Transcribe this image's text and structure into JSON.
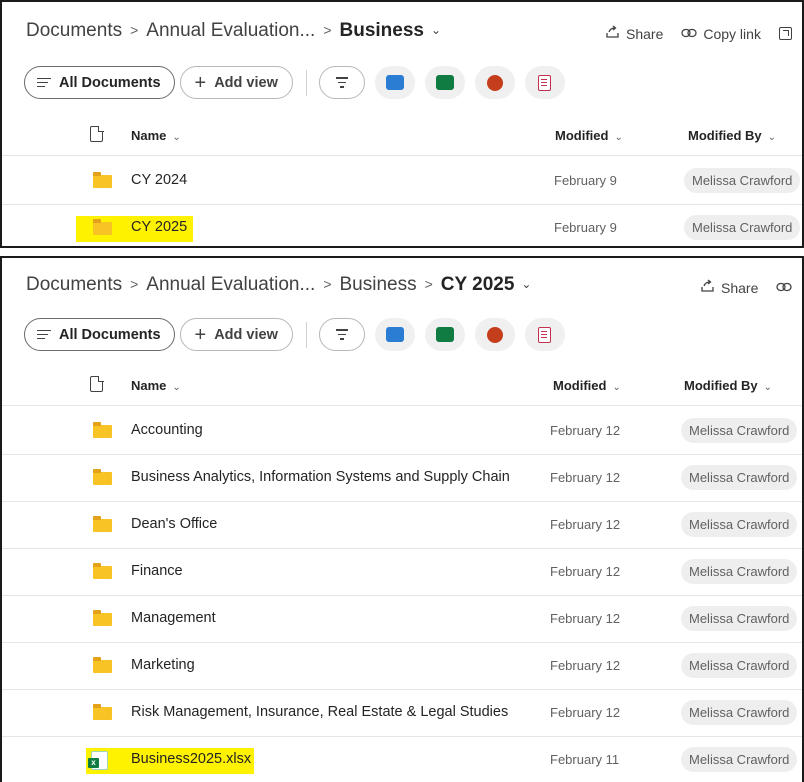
{
  "top_view": {
    "breadcrumb": {
      "items": [
        "Documents",
        "Annual Evaluation..."
      ],
      "current": "Business",
      "separator": ">",
      "chevron": "⌄"
    },
    "actions": {
      "share_label": "Share",
      "copy_link_label": "Copy link"
    },
    "toolbar": {
      "all_documents_label": "All Documents",
      "add_view_label": "Add view",
      "add_icon": "+"
    },
    "columns": {
      "name": "Name",
      "modified": "Modified",
      "modified_by": "Modified By",
      "sort_chevron": "⌄"
    },
    "rows": [
      {
        "name": "CY 2024",
        "modified": "February 9",
        "modified_by": "Melissa Crawford",
        "type": "folder",
        "highlighted": false
      },
      {
        "name": "CY 2025",
        "modified": "February 9",
        "modified_by": "Melissa Crawford",
        "type": "folder",
        "highlighted": true
      }
    ]
  },
  "bottom_view": {
    "breadcrumb": {
      "items": [
        "Documents",
        "Annual Evaluation...",
        "Business"
      ],
      "current": "CY 2025",
      "separator": ">",
      "chevron": "⌄"
    },
    "actions": {
      "share_label": "Share"
    },
    "toolbar": {
      "all_documents_label": "All Documents",
      "add_view_label": "Add view",
      "add_icon": "+"
    },
    "columns": {
      "name": "Name",
      "modified": "Modified",
      "modified_by": "Modified By",
      "sort_chevron": "⌄"
    },
    "rows": [
      {
        "name": "Accounting",
        "modified": "February 12",
        "modified_by": "Melissa Crawford",
        "type": "folder",
        "highlighted": false
      },
      {
        "name": "Business Analytics, Information Systems and Supply Chain",
        "modified": "February 12",
        "modified_by": "Melissa Crawford",
        "type": "folder",
        "highlighted": false
      },
      {
        "name": "Dean's Office",
        "modified": "February 12",
        "modified_by": "Melissa Crawford",
        "type": "folder",
        "highlighted": false
      },
      {
        "name": "Finance",
        "modified": "February 12",
        "modified_by": "Melissa Crawford",
        "type": "folder",
        "highlighted": false
      },
      {
        "name": "Management",
        "modified": "February 12",
        "modified_by": "Melissa Crawford",
        "type": "folder",
        "highlighted": false
      },
      {
        "name": "Marketing",
        "modified": "February 12",
        "modified_by": "Melissa Crawford",
        "type": "folder",
        "highlighted": false
      },
      {
        "name": "Risk Management, Insurance, Real Estate & Legal Studies",
        "modified": "February 12",
        "modified_by": "Melissa Crawford",
        "type": "folder",
        "highlighted": false
      },
      {
        "name": "Business2025.xlsx",
        "modified": "February 11",
        "modified_by": "Melissa Crawford",
        "type": "excel-file",
        "highlighted": true
      }
    ]
  },
  "colors": {
    "highlight": "#fff200",
    "folder": "#f7c325",
    "excel": "#107c41",
    "word": "#2b7cd3",
    "powerpoint": "#c43e1c",
    "forms": "#c4314b"
  },
  "icons": [
    "folder-icon",
    "excel-file-icon",
    "share-icon",
    "copy-link-icon",
    "open-icon",
    "filter-icon",
    "word-icon",
    "excel-icon",
    "powerpoint-icon",
    "forms-icon",
    "document-icon"
  ]
}
